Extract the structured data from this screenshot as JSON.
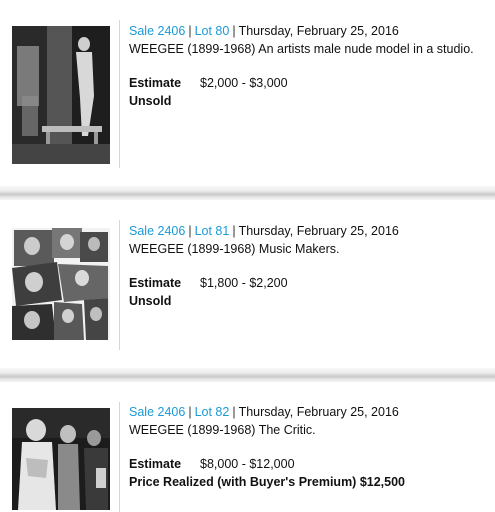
{
  "lots": [
    {
      "sale_label": "Sale 2406",
      "lot_label": "Lot 80",
      "date": "Thursday, February 25, 2016",
      "title": "WEEGEE (1899-1968) An artists male nude model in a studio.",
      "estimate_label": "Estimate",
      "estimate_value": "$2,000 - $3,000",
      "status": "Unsold"
    },
    {
      "sale_label": "Sale 2406",
      "lot_label": "Lot 81",
      "date": "Thursday, February 25, 2016",
      "title": "WEEGEE (1899-1968) Music Makers.",
      "estimate_label": "Estimate",
      "estimate_value": "$1,800 - $2,200",
      "status": "Unsold"
    },
    {
      "sale_label": "Sale 2406",
      "lot_label": "Lot 82",
      "date": "Thursday, February 25, 2016",
      "title": "WEEGEE (1899-1968) The Critic.",
      "estimate_label": "Estimate",
      "estimate_value": "$8,000 - $12,000",
      "status": "Price Realized (with Buyer's Premium) $12,500"
    }
  ],
  "colors": {
    "link": "#1b9ad6",
    "text": "#111111",
    "separator_line": "#d6d6d6"
  }
}
